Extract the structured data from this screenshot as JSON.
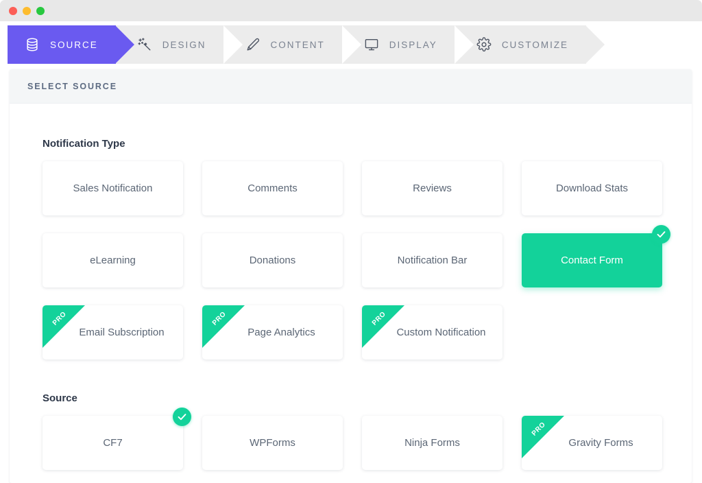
{
  "window": {
    "traffic_lights": [
      {
        "name": "close",
        "color": "#fc5f57"
      },
      {
        "name": "minimize",
        "color": "#fdbc2e"
      },
      {
        "name": "zoom",
        "color": "#28c840"
      }
    ]
  },
  "colors": {
    "active_step": "#6a5af0",
    "step_inactive_bg": "#ececec",
    "accent_green": "#13d29a",
    "panel_header_bg": "#f4f6f7",
    "text_muted": "#5b6675"
  },
  "steps": [
    {
      "label": "SOURCE",
      "icon": "database-icon",
      "active": true
    },
    {
      "label": "DESIGN",
      "icon": "magic-wand-icon",
      "active": false
    },
    {
      "label": "CONTENT",
      "icon": "pencil-icon",
      "active": false
    },
    {
      "label": "DISPLAY",
      "icon": "monitor-icon",
      "active": false
    },
    {
      "label": "CUSTOMIZE",
      "icon": "gear-icon",
      "active": false
    }
  ],
  "panel": {
    "header_title": "SELECT SOURCE",
    "sections": [
      {
        "title": "Notification Type",
        "cards": [
          {
            "label": "Sales Notification",
            "pro": false,
            "selected": false
          },
          {
            "label": "Comments",
            "pro": false,
            "selected": false
          },
          {
            "label": "Reviews",
            "pro": false,
            "selected": false
          },
          {
            "label": "Download Stats",
            "pro": false,
            "selected": false
          },
          {
            "label": "eLearning",
            "pro": false,
            "selected": false
          },
          {
            "label": "Donations",
            "pro": false,
            "selected": false
          },
          {
            "label": "Notification Bar",
            "pro": false,
            "selected": false
          },
          {
            "label": "Contact Form",
            "pro": false,
            "selected": true
          },
          {
            "label": "Email Subscription",
            "pro": true,
            "selected": false
          },
          {
            "label": "Page Analytics",
            "pro": true,
            "selected": false
          },
          {
            "label": "Custom Notification",
            "pro": true,
            "selected": false
          }
        ]
      },
      {
        "title": "Source",
        "cards": [
          {
            "label": "CF7",
            "pro": false,
            "selected": true
          },
          {
            "label": "WPForms",
            "pro": false,
            "selected": false
          },
          {
            "label": "Ninja Forms",
            "pro": false,
            "selected": false
          },
          {
            "label": "Gravity Forms",
            "pro": true,
            "selected": false
          }
        ]
      }
    ],
    "pro_badge_label": "PRO"
  }
}
